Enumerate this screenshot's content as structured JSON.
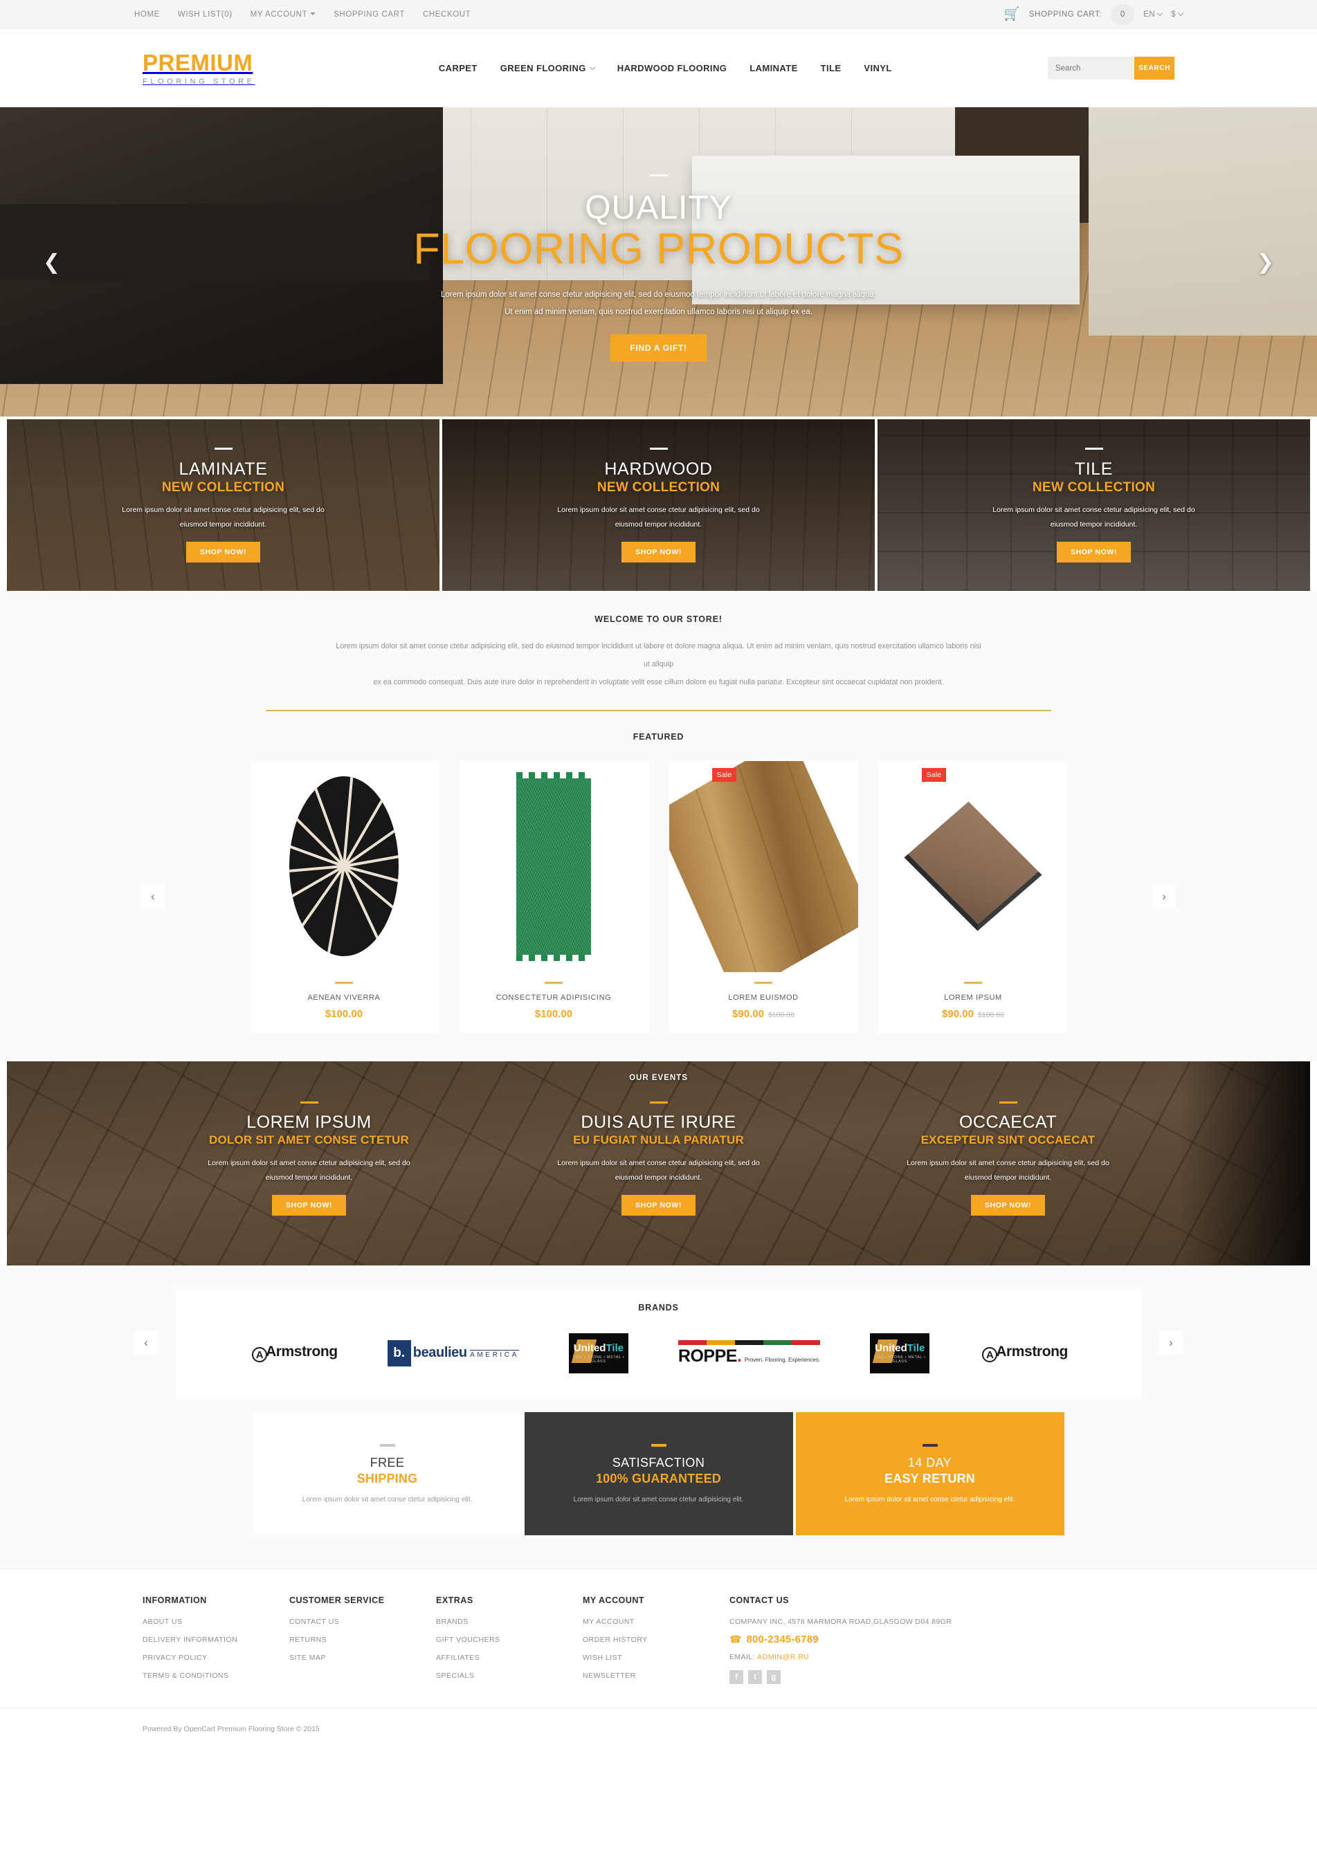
{
  "topbar": {
    "links": [
      {
        "label": "HOME",
        "caret": false
      },
      {
        "label": "WISH LIST(0)",
        "caret": false
      },
      {
        "label": "MY ACCOUNT",
        "caret": true
      },
      {
        "label": "SHOPPING CART",
        "caret": false
      },
      {
        "label": "CHECKOUT",
        "caret": false
      }
    ],
    "cart_label": "SHOPPING CART:",
    "cart_count": "0",
    "language": "EN",
    "currency": "$"
  },
  "header": {
    "logo_main": "PREMIUM",
    "logo_sub": "FLOORING STORE",
    "nav": [
      {
        "label": "CARPET",
        "caret": false
      },
      {
        "label": "GREEN FLOORING",
        "caret": true
      },
      {
        "label": "HARDWOOD FLOORING",
        "caret": false
      },
      {
        "label": "LAMINATE",
        "caret": false
      },
      {
        "label": "TILE",
        "caret": false
      },
      {
        "label": "VINYL",
        "caret": false
      }
    ],
    "search_placeholder": "Search",
    "search_value": "",
    "search_button": "SEARCH"
  },
  "hero": {
    "title_line1": "QUALITY",
    "title_line2": "FLOORING PRODUCTS",
    "paragraph_line1": "Lorem ipsum dolor sit amet conse ctetur adipisicing elit, sed do eiusmod tempor incididunt ut labore et dolore magna aliqua.",
    "paragraph_line2": "Ut enim ad minim veniam, quis nostrud exercitation ullamco laboris nisi ut aliquip ex ea.",
    "button": "FIND A GIFT!",
    "prev_icon": "chevron-left",
    "next_icon": "chevron-right"
  },
  "categories": [
    {
      "title": "LAMINATE",
      "subtitle": "NEW COLLECTION",
      "text": "Lorem ipsum dolor sit amet conse ctetur adipisicing elit, sed do eiusmod tempor incididunt.",
      "button": "SHOP NOW!"
    },
    {
      "title": "HARDWOOD",
      "subtitle": "NEW COLLECTION",
      "text": "Lorem ipsum dolor sit amet conse ctetur adipisicing elit, sed do eiusmod tempor incididunt.",
      "button": "SHOP NOW!"
    },
    {
      "title": "TILE",
      "subtitle": "NEW COLLECTION",
      "text": "Lorem ipsum dolor sit amet conse ctetur adipisicing elit, sed do eiusmod tempor incididunt.",
      "button": "SHOP NOW!"
    }
  ],
  "welcome": {
    "title": "WELCOME TO OUR STORE!",
    "paragraph_line1": "Lorem ipsum dolor sit amet conse ctetur adipisicing elit, sed do eiusmod tempor incididunt ut labore et dolore magna aliqua. Ut enim ad minim veniam, quis nostrud exercitation ullamco laboris nisi ut aliquip",
    "paragraph_line2": "ex ea commodo consequat. Duis aute irure dolor in reprehenderit in voluptate velit esse cillum dolore eu fugiat nulla pariatur. Excepteur sint occaecat cupidatat non proident."
  },
  "featured": {
    "title": "FEATURED",
    "prev_icon": "chevron-left",
    "next_icon": "chevron-right",
    "products": [
      {
        "name": "AENEAN VIVERRA",
        "price": "$100.00",
        "old_price": "",
        "sale": false,
        "sale_label": ""
      },
      {
        "name": "CONSECTETUR ADIPISICING",
        "price": "$100.00",
        "old_price": "",
        "sale": false,
        "sale_label": ""
      },
      {
        "name": "LOREM EUISMOD",
        "price": "$90.00",
        "old_price": "$100.00",
        "sale": true,
        "sale_label": "Sale"
      },
      {
        "name": "LOREM IPSUM",
        "price": "$90.00",
        "old_price": "$100.00",
        "sale": true,
        "sale_label": "Sale"
      }
    ]
  },
  "events": {
    "title": "OUR EVENTS",
    "items": [
      {
        "title": "LOREM IPSUM",
        "subtitle": "DOLOR SIT AMET CONSE CTETUR",
        "text": "Lorem ipsum dolor sit amet conse ctetur adipisicing elit, sed do eiusmod tempor incididunt.",
        "button": "SHOP NOW!"
      },
      {
        "title": "DUIS AUTE IRURE",
        "subtitle": "EU FUGIAT NULLA PARIATUR",
        "text": "Lorem ipsum dolor sit amet conse ctetur adipisicing elit, sed do eiusmod tempor incididunt.",
        "button": "SHOP NOW!"
      },
      {
        "title": "OCCAECAT",
        "subtitle": "EXCEPTEUR SINT OCCAECAT",
        "text": "Lorem ipsum dolor sit amet conse ctetur adipisicing elit, sed do eiusmod tempor incididunt.",
        "button": "SHOP NOW!"
      }
    ]
  },
  "brands": {
    "title": "BRANDS",
    "prev_icon": "chevron-left",
    "next_icon": "chevron-right",
    "items": [
      {
        "name": "Armstrong",
        "type": "armstrong"
      },
      {
        "name": "beaulieu AMERICA",
        "type": "beaulieu",
        "mark": "b.",
        "main": "beaulieu",
        "sub": "AMERICA"
      },
      {
        "name": "UnitedTile",
        "type": "unitedtile",
        "main_a": "United",
        "main_b": "Tile",
        "sub": "TILE • STONE • METAL • GLASS"
      },
      {
        "name": "ROPPE",
        "type": "roppe",
        "main": "ROPPE",
        "sub": "Proven. Flooring. Experiences."
      },
      {
        "name": "UnitedTile",
        "type": "unitedtile",
        "main_a": "United",
        "main_b": "Tile",
        "sub": "TILE • STONE • METAL • GLASS"
      },
      {
        "name": "Armstrong",
        "type": "armstrong"
      }
    ]
  },
  "promos": [
    {
      "line1": "FREE",
      "line2": "SHIPPING",
      "text": "Lorem ipsum dolor sit amet conse ctetur adipisicing elit.",
      "style": "white"
    },
    {
      "line1": "SATISFACTION",
      "line2": "100% GUARANTEED",
      "text": "Lorem ipsum dolor sit amet conse ctetur adipisicing elit.",
      "style": "dark"
    },
    {
      "line1": "14 DAY",
      "line2": "EASY RETURN",
      "text": "Lorem ipsum dolor sit amet conse ctetur adipisicing elit.",
      "style": "gold"
    }
  ],
  "footer": {
    "columns": [
      {
        "heading": "INFORMATION",
        "links": [
          "ABOUT US",
          "DELIVERY INFORMATION",
          "PRIVACY POLICY",
          "TERMS & CONDITIONS"
        ]
      },
      {
        "heading": "CUSTOMER SERVICE",
        "links": [
          "CONTACT US",
          "RETURNS",
          "SITE MAP"
        ]
      },
      {
        "heading": "EXTRAS",
        "links": [
          "BRANDS",
          "GIFT VOUCHERS",
          "AFFILIATES",
          "SPECIALS"
        ]
      },
      {
        "heading": "MY ACCOUNT",
        "links": [
          "MY ACCOUNT",
          "ORDER HISTORY",
          "WISH LIST",
          "NEWSLETTER"
        ]
      }
    ],
    "contact": {
      "heading": "CONTACT US",
      "address": "COMPANY INC, 4578 MARMORA ROAD,GLASGOW D04 89GR",
      "phone": "800-2345-6789",
      "email_label": "EMAIL:",
      "email": "ADMIN@R.RU",
      "socials": [
        "facebook",
        "twitter",
        "google-plus"
      ]
    },
    "copyright": "Powered By OpenCart Premium Flooring Store © 2015"
  },
  "colors": {
    "accent": "#f5a623",
    "sale": "#f03d2e",
    "dark": "#3a3a3a",
    "muted": "#8d8d8d"
  }
}
